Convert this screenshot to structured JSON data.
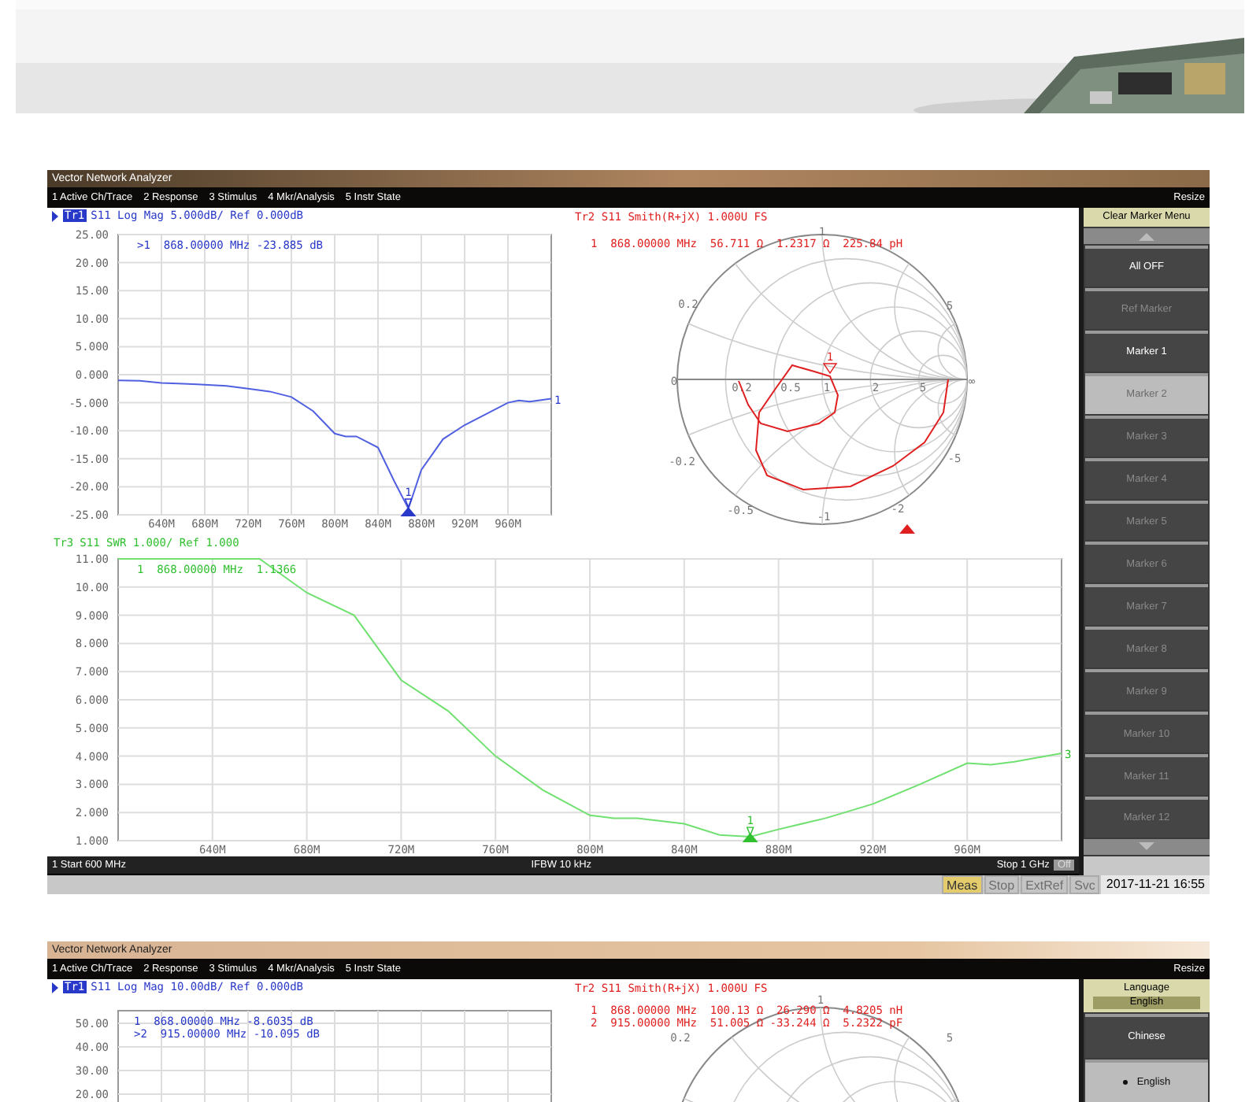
{
  "screens": [
    {
      "title": "Vector Network Analyzer",
      "menu": [
        "1 Active Ch/Trace",
        "2 Response",
        "3 Stimulus",
        "4 Mkr/Analysis",
        "5 Instr State"
      ],
      "resize": "Resize",
      "logmag": {
        "trace": {
          "label": "Tr1",
          "active": true,
          "color": "#2838c8"
        },
        "header": "S11 Log Mag 5.000dB/ Ref 0.000dB",
        "markers": [
          ">1  868.00000 MHz -23.885 dB"
        ],
        "chart_data": {
          "type": "line",
          "x": [
            600,
            620,
            640,
            660,
            680,
            700,
            720,
            740,
            760,
            780,
            800,
            810,
            820,
            840,
            855,
            868,
            880,
            900,
            920,
            940,
            960,
            970,
            980,
            1000
          ],
          "grid": true,
          "series": [
            {
              "color": "#5060e0",
              "values": [
                -1,
                -1.1,
                -1.5,
                -1.6,
                -1.8,
                -2,
                -2.5,
                -3,
                -4,
                -6.5,
                -10.5,
                -11,
                -11,
                -13,
                -19,
                -23.9,
                -17,
                -11.5,
                -9,
                -7,
                -5,
                -4.6,
                -4.8,
                -4.3
              ]
            }
          ],
          "xlim": [
            600,
            1000
          ],
          "ylim": [
            -25,
            25
          ],
          "xticks": [
            {
              "value": 640,
              "label": "640M"
            },
            {
              "value": 680,
              "label": "680M"
            },
            {
              "value": 720,
              "label": "720M"
            },
            {
              "value": 760,
              "label": "760M"
            },
            {
              "value": 800,
              "label": "800M"
            },
            {
              "value": 840,
              "label": "840M"
            },
            {
              "value": 880,
              "label": "880M"
            },
            {
              "value": 920,
              "label": "920M"
            },
            {
              "value": 960,
              "label": "960M"
            }
          ],
          "yticks": [
            {
              "value": 25,
              "label": "25.00"
            },
            {
              "value": 20,
              "label": "20.00"
            },
            {
              "value": 15,
              "label": "15.00"
            },
            {
              "value": 10,
              "label": "10.00"
            },
            {
              "value": 5,
              "label": "5.000"
            },
            {
              "value": 0,
              "label": "0.000"
            },
            {
              "value": -5,
              "label": "-5.000"
            },
            {
              "value": -10,
              "label": "-10.00"
            },
            {
              "value": -15,
              "label": "-15.00"
            },
            {
              "value": -20,
              "label": "-20.00"
            },
            {
              "value": -25,
              "label": "-25.00"
            }
          ],
          "annotations": [
            {
              "x": 868,
              "y": -23.885,
              "text": "1"
            }
          ]
        },
        "trace_number": "1"
      },
      "smith": {
        "header": "Tr2 S11 Smith(R+jX) 1.000U FS",
        "color": "#e02020",
        "markers": [
          "1  868.00000 MHz  56.711 Ω  1.2317 Ω  225.84 pH"
        ],
        "trace_visible": true,
        "marker_label": "1",
        "labels": [
          "1",
          "0.2",
          "5",
          "0",
          "0.2",
          "0.5",
          "1",
          "2",
          "5",
          "∞",
          "-0.2",
          "-5",
          "-0.5",
          "-1",
          "-2"
        ]
      },
      "swr": {
        "trace": {
          "label": "Tr3",
          "active": false,
          "color": "#30c030"
        },
        "header": "S11 SWR 1.000/ Ref 1.000",
        "markers": [
          "1  868.00000 MHz  1.1366"
        ],
        "chart_data": {
          "type": "line",
          "x": [
            600,
            620,
            640,
            660,
            680,
            700,
            720,
            740,
            760,
            780,
            800,
            810,
            820,
            840,
            855,
            868,
            880,
            900,
            920,
            940,
            960,
            970,
            980,
            1000
          ],
          "grid": true,
          "series": [
            {
              "color": "#70e070",
              "values": [
                11,
                11,
                11,
                11,
                9.8,
                9,
                6.7,
                5.6,
                4,
                2.8,
                1.9,
                1.8,
                1.8,
                1.6,
                1.2,
                1.14,
                1.4,
                1.8,
                2.3,
                3,
                3.75,
                3.7,
                3.8,
                4.1
              ]
            }
          ],
          "xlim": [
            600,
            1000
          ],
          "ylim": [
            1,
            11
          ],
          "xticks": [
            {
              "value": 640,
              "label": "640M"
            },
            {
              "value": 680,
              "label": "680M"
            },
            {
              "value": 720,
              "label": "720M"
            },
            {
              "value": 760,
              "label": "760M"
            },
            {
              "value": 800,
              "label": "800M"
            },
            {
              "value": 840,
              "label": "840M"
            },
            {
              "value": 880,
              "label": "880M"
            },
            {
              "value": 920,
              "label": "920M"
            },
            {
              "value": 960,
              "label": "960M"
            }
          ],
          "yticks": [
            {
              "value": 11,
              "label": "11.00"
            },
            {
              "value": 10,
              "label": "10.00"
            },
            {
              "value": 9,
              "label": "9.000"
            },
            {
              "value": 8,
              "label": "8.000"
            },
            {
              "value": 7,
              "label": "7.000"
            },
            {
              "value": 6,
              "label": "6.000"
            },
            {
              "value": 5,
              "label": "5.000"
            },
            {
              "value": 4,
              "label": "4.000"
            },
            {
              "value": 3,
              "label": "3.000"
            },
            {
              "value": 2,
              "label": "2.000"
            },
            {
              "value": 1,
              "label": "1.000"
            }
          ],
          "annotations": [
            {
              "x": 868,
              "y": 1.1366,
              "text": "1"
            }
          ]
        },
        "trace_number": "3"
      },
      "status": {
        "start": "1 Start 600 MHz",
        "ifbw": "IFBW 10 kHz",
        "stop": "Stop 1 GHz",
        "badge": "Off"
      },
      "softkeys": {
        "title": "Clear Marker Menu",
        "kind": "menu",
        "scrollable": true,
        "items": [
          {
            "label": "All OFF",
            "enabled": true,
            "selected": false
          },
          {
            "label": "Ref Marker",
            "enabled": false,
            "selected": false
          },
          {
            "label": "Marker 1",
            "enabled": true,
            "selected": false
          },
          {
            "label": "Marker 2",
            "enabled": false,
            "selected": true
          },
          {
            "label": "Marker 3",
            "enabled": false,
            "selected": false
          },
          {
            "label": "Marker 4",
            "enabled": false,
            "selected": false
          },
          {
            "label": "Marker 5",
            "enabled": false,
            "selected": false
          },
          {
            "label": "Marker 6",
            "enabled": false,
            "selected": false
          },
          {
            "label": "Marker 7",
            "enabled": false,
            "selected": false
          },
          {
            "label": "Marker 8",
            "enabled": false,
            "selected": false
          },
          {
            "label": "Marker 9",
            "enabled": false,
            "selected": false
          },
          {
            "label": "Marker 10",
            "enabled": false,
            "selected": false
          },
          {
            "label": "Marker 11",
            "enabled": false,
            "selected": false
          },
          {
            "label": "Marker 12",
            "enabled": false,
            "selected": false
          }
        ]
      },
      "indicators": [
        {
          "label": "Meas",
          "active": true
        },
        {
          "label": "Stop",
          "active": false
        },
        {
          "label": "ExtRef",
          "active": false
        },
        {
          "label": "Svc",
          "active": false
        }
      ],
      "datetime": "2017-11-21 16:55"
    },
    {
      "title": "Vector Network Analyzer",
      "menu": [
        "1 Active Ch/Trace",
        "2 Response",
        "3 Stimulus",
        "4 Mkr/Analysis",
        "5 Instr State"
      ],
      "resize": "Resize",
      "logmag": {
        "trace": {
          "label": "Tr1",
          "active": true,
          "color": "#2838c8"
        },
        "header": "S11 Log Mag 10.00dB/ Ref 0.000dB",
        "markers": [
          "1  868.00000 MHz -8.6035 dB",
          ">2  915.00000 MHz -10.095 dB"
        ],
        "y_labels": [
          "50.00",
          "40.00",
          "30.00",
          "20.00"
        ]
      },
      "smith": {
        "header": "Tr2 S11 Smith(R+jX) 1.000U FS",
        "color": "#e02020",
        "markers": [
          "1  868.00000 MHz  100.13 Ω  26.290 Ω  4.8205 nH",
          "2  915.00000 MHz  51.005 Ω -33.244 Ω  5.2322 pF"
        ],
        "labels": [
          "1",
          "0.2",
          "5"
        ]
      },
      "softkeys": {
        "title": "Language",
        "value": "English",
        "kind": "radio",
        "items": [
          {
            "label": "Chinese",
            "selected": false
          },
          {
            "label": "English",
            "selected": true
          }
        ]
      }
    }
  ]
}
